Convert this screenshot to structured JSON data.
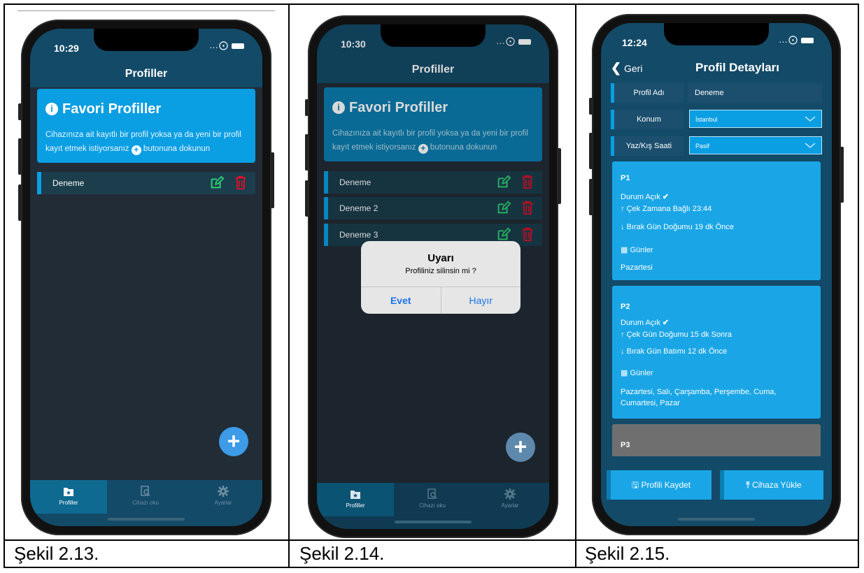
{
  "panels": [
    {
      "time": "10:29",
      "title": "Profiller",
      "favorites": {
        "heading": "Favori Profiller",
        "desc_before": "Cihazınıza ait kayıtlı bir profil yoksa ya da yeni bir profil kayıt etmek istiyorsanız",
        "desc_after": "butonuna dokunun"
      },
      "profiles": [
        "Deneme"
      ],
      "tabs": [
        "Profiller",
        "Cihazı oku",
        "Ayarlar"
      ],
      "caption": "Şekil 2.13."
    },
    {
      "time": "10:30",
      "title": "Profiller",
      "favorites": {
        "heading": "Favori Profiller",
        "desc_before": "Cihazınıza ait kayıtlı bir profil yoksa ya da yeni bir profil kayıt etmek istiyorsanız",
        "desc_after": "butonuna dokunun"
      },
      "profiles": [
        "Deneme",
        "Deneme 2",
        "Deneme 3"
      ],
      "alert": {
        "title": "Uyarı",
        "message": "Profiliniz silinsin mi ?",
        "confirm": "Evet",
        "cancel": "Hayır"
      },
      "tabs": [
        "Profiller",
        "Cihazı oku",
        "Ayarlar"
      ],
      "caption": "Şekil 2.14."
    },
    {
      "time": "12:24",
      "back": "Geri",
      "title": "Profil Detayları",
      "fields": {
        "name_label": "Profil Adı",
        "name_value": "Deneme",
        "location_label": "Konum",
        "location_value": "İstanbul",
        "dst_label": "Yaz/Kış Saati",
        "dst_value": "Pasif"
      },
      "programs": [
        {
          "name": "P1",
          "status": "Durum Açık",
          "pull": "Çek Zamana Bağlı  23:44",
          "release": "Bırak Gün Doğumu 19  dk Önce",
          "days_label": "Günler",
          "days": "Pazartesi"
        },
        {
          "name": "P2",
          "status": "Durum Açık",
          "pull": "Çek Gün Doğumu 15  dk Sonra",
          "release": "Bırak Gün Batımı 12  dk Önce",
          "days_label": "Günler",
          "days": "Pazartesi, Salı, Çarşamba, Perşembe, Cuma, Cumartesi, Pazar"
        },
        {
          "name": "P3"
        }
      ],
      "buttons": {
        "save": "Profili Kaydet",
        "upload": "Cihaza Yükle"
      },
      "caption": "Şekil 2.15."
    }
  ],
  "colors": {
    "accent": "#0a9ee3",
    "bar": "#134a68",
    "background": "#222c36",
    "edit": "#2ecc71",
    "delete": "#d0142c",
    "alert_button": "#1a73e8"
  }
}
